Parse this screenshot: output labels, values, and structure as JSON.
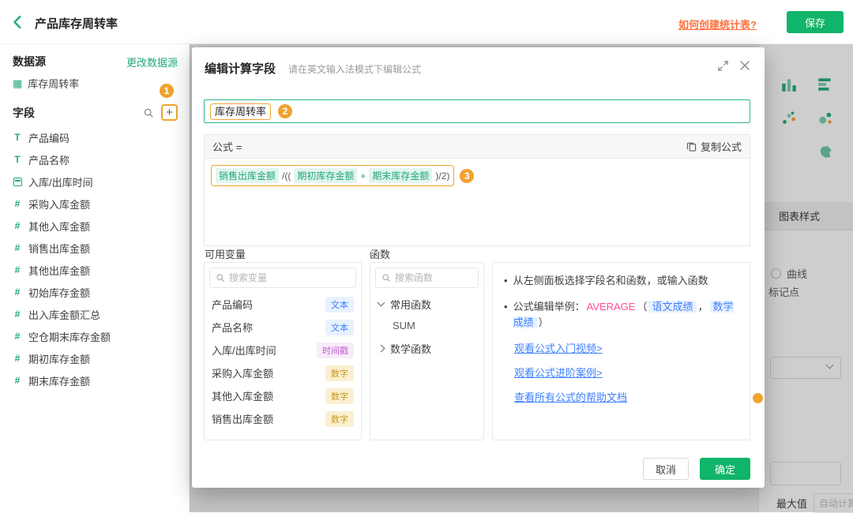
{
  "colors": {
    "accent_green": "#10b46a",
    "accent_teal": "#21a97e",
    "annotation_orange": "#f0a32f",
    "link_orange": "#ff6f3c",
    "token_blue": "#3d7fff"
  },
  "topbar": {
    "title": "产品库存周转率",
    "help_link": "如何创建统计表?",
    "save_label": "保存"
  },
  "sidebar": {
    "datasource_label": "数据源",
    "change_datasource_label": "更改数据源",
    "datasource_name": "库存周转率",
    "fields_label": "字段",
    "fields": [
      {
        "name": "产品编码",
        "type": "text"
      },
      {
        "name": "产品名称",
        "type": "text"
      },
      {
        "name": "入库/出库时间",
        "type": "date"
      },
      {
        "name": "采购入库金额",
        "type": "number"
      },
      {
        "name": "其他入库金额",
        "type": "number"
      },
      {
        "name": "销售出库金额",
        "type": "number"
      },
      {
        "name": "其他出库金额",
        "type": "number"
      },
      {
        "name": "初始库存金额",
        "type": "number"
      },
      {
        "name": "出入库金额汇总",
        "type": "number"
      },
      {
        "name": "空仓期末库存金额",
        "type": "number"
      },
      {
        "name": "期初库存金额",
        "type": "number"
      },
      {
        "name": "期末库存金额",
        "type": "number"
      }
    ]
  },
  "modal": {
    "title": "编辑计算字段",
    "subtitle": "请在英文输入法模式下编辑公式",
    "field_name_value": "库存周转率",
    "formula_label": "公式 =",
    "copy_formula_label": "复制公式",
    "formula_tokens": [
      {
        "type": "field",
        "text": "销售出库金额"
      },
      {
        "type": "op",
        "text": "/(("
      },
      {
        "type": "field",
        "text": "期初库存金额"
      },
      {
        "type": "plus",
        "text": "+"
      },
      {
        "type": "field",
        "text": "期末库存金额"
      },
      {
        "type": "op",
        "text": ")/2)"
      }
    ],
    "variables": {
      "label": "可用变量",
      "search_placeholder": "搜索变量",
      "items": [
        {
          "name": "产品编码",
          "badge": "文本",
          "badge_type": "text"
        },
        {
          "name": "产品名称",
          "badge": "文本",
          "badge_type": "text"
        },
        {
          "name": "入库/出库时间",
          "badge": "时间戳",
          "badge_type": "timestamp"
        },
        {
          "name": "采购入库金额",
          "badge": "数字",
          "badge_type": "number"
        },
        {
          "name": "其他入库金额",
          "badge": "数字",
          "badge_type": "number"
        },
        {
          "name": "销售出库金额",
          "badge": "数字",
          "badge_type": "number"
        }
      ]
    },
    "functions": {
      "label": "函数",
      "search_placeholder": "搜索函数",
      "groups": [
        {
          "name": "常用函数",
          "expanded": true,
          "children": [
            "SUM"
          ]
        },
        {
          "name": "数学函数",
          "expanded": false,
          "children": []
        }
      ]
    },
    "help": {
      "tip1": "从左侧面板选择字段名和函数，或输入函数",
      "tip2_prefix": "公式编辑举例：",
      "example_function": "AVERAGE",
      "example_open": "（",
      "example_args": [
        "语文成绩",
        "数学成绩"
      ],
      "example_separator": "，",
      "example_close": "）",
      "links": [
        "观看公式入门视频>",
        "观看公式进阶案例>",
        "查看所有公式的帮助文档"
      ]
    },
    "cancel_label": "取消",
    "confirm_label": "确定"
  },
  "config_panel": {
    "chart_style_tab": "图表样式",
    "curve_label": "曲线",
    "marker_label": "标记点",
    "max_label": "最大值",
    "max_placeholder": "自动计算"
  },
  "annotations": {
    "one": "1",
    "two": "2",
    "three": "3"
  }
}
